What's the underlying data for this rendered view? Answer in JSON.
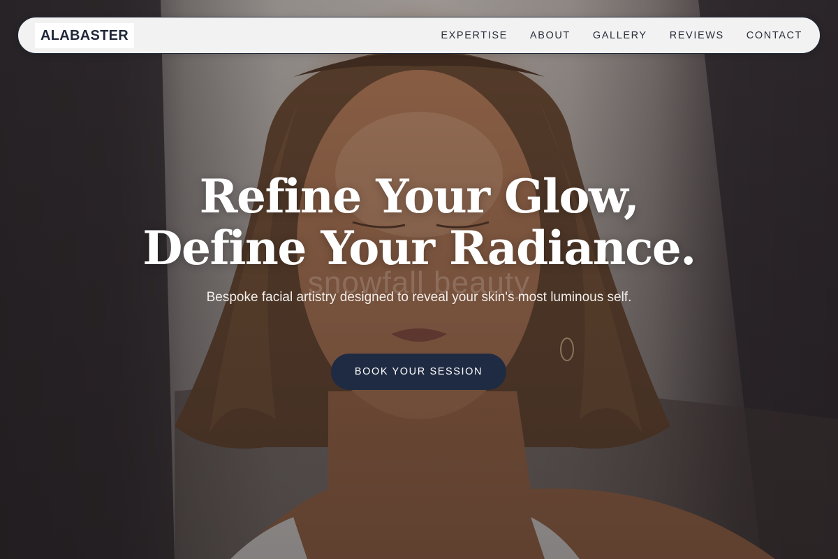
{
  "brand": {
    "logo_text": "ALABASTER"
  },
  "nav": {
    "items": [
      {
        "label": "EXPERTISE"
      },
      {
        "label": "ABOUT"
      },
      {
        "label": "GALLERY"
      },
      {
        "label": "REVIEWS"
      },
      {
        "label": "CONTACT"
      }
    ]
  },
  "hero": {
    "headline_line1": "Refine Your Glow,",
    "headline_line2": "Define Your Radiance.",
    "watermark": "snowfall beauty",
    "subheadline": "Bespoke facial artistry designed to reveal your skin's most luminous self.",
    "cta_label": "BOOK YOUR SESSION"
  },
  "colors": {
    "navy": "#1f2b42",
    "nav_background": "#f2f2f3",
    "text_dark": "#1f2838"
  }
}
